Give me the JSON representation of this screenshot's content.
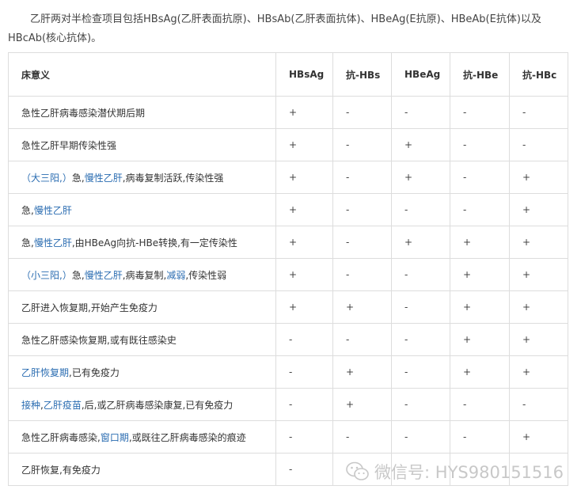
{
  "intro": {
    "text": "乙肝两对半检查项目包括HBsAg(乙肝表面抗原)、HBsAb(乙肝表面抗体)、HBeAg(E抗原)、HBeAb(E抗体)以及HBcAb(核心抗体)。"
  },
  "table": {
    "headers": [
      "床意义",
      "HBsAg",
      "抗-HBs",
      "HBeAg",
      "抗-HBe",
      "抗-HBc"
    ],
    "rows": [
      {
        "meaning": [
          {
            "t": "急性乙肝病毒感染潜伏期后期"
          }
        ],
        "marks": [
          "+",
          "-",
          "-",
          "-",
          "-"
        ]
      },
      {
        "meaning": [
          {
            "t": "急性乙肝早期传染性强"
          }
        ],
        "marks": [
          "+",
          "-",
          "+",
          "-",
          "-"
        ]
      },
      {
        "meaning": [
          {
            "t": "（",
            "link": true
          },
          {
            "t": "大三阳",
            "link": true
          },
          {
            "t": ",）",
            "link": true
          },
          {
            "t": "急,"
          },
          {
            "t": "慢性乙肝",
            "link": true
          },
          {
            "t": ",病毒复制活跃,传染性强"
          }
        ],
        "marks": [
          "+",
          "-",
          "+",
          "-",
          "+"
        ]
      },
      {
        "meaning": [
          {
            "t": "急,"
          },
          {
            "t": "慢性乙肝",
            "link": true
          }
        ],
        "marks": [
          "+",
          "-",
          "-",
          "-",
          "+"
        ]
      },
      {
        "meaning": [
          {
            "t": "急,"
          },
          {
            "t": "慢性乙肝",
            "link": true
          },
          {
            "t": ",由HBeAg向抗-HBe转换,有一定传染性"
          }
        ],
        "marks": [
          "+",
          "-",
          "+",
          "+",
          "+"
        ]
      },
      {
        "meaning": [
          {
            "t": "（",
            "link": true
          },
          {
            "t": "小三阳",
            "link": true
          },
          {
            "t": ",）",
            "link": true
          },
          {
            "t": "急,"
          },
          {
            "t": "慢性乙肝",
            "link": true
          },
          {
            "t": ",病毒复制,"
          },
          {
            "t": "减弱",
            "link": true
          },
          {
            "t": ",传染性弱"
          }
        ],
        "marks": [
          "+",
          "-",
          "-",
          "+",
          "+"
        ]
      },
      {
        "meaning": [
          {
            "t": "乙肝进入恢复期,开始产生免疫力"
          }
        ],
        "marks": [
          "+",
          "+",
          "-",
          "+",
          "+"
        ]
      },
      {
        "meaning": [
          {
            "t": "急性乙肝感染恢复期,或有既往感染史"
          }
        ],
        "marks": [
          "-",
          "-",
          "-",
          "+",
          "+"
        ]
      },
      {
        "meaning": [
          {
            "t": "乙肝恢复期",
            "link": true
          },
          {
            "t": ",已有免疫力"
          }
        ],
        "marks": [
          "-",
          "+",
          "-",
          "+",
          "+"
        ]
      },
      {
        "meaning": [
          {
            "t": "接种",
            "link": true
          },
          {
            "t": ","
          },
          {
            "t": "乙肝疫苗",
            "link": true
          },
          {
            "t": ",后,或乙肝病毒感染康复,已有免疫力"
          }
        ],
        "marks": [
          "-",
          "+",
          "-",
          "-",
          "-"
        ]
      },
      {
        "meaning": [
          {
            "t": "急性乙肝病毒感染,"
          },
          {
            "t": "窗口期",
            "link": true
          },
          {
            "t": ",或既往乙肝病毒感染的痕迹"
          }
        ],
        "marks": [
          "-",
          "-",
          "-",
          "-",
          "+"
        ]
      },
      {
        "meaning": [
          {
            "t": "乙肝恢复,有免疫力"
          }
        ],
        "marks": [
          "-",
          "",
          "",
          "",
          ""
        ]
      }
    ]
  },
  "watermark": {
    "text": "微信号: HYS980151516",
    "icon": "wechat-icon"
  },
  "colors": {
    "link": "#2a6cb1",
    "border": "#dddddd",
    "text": "#333333",
    "watermark": "#c8c8c8"
  }
}
